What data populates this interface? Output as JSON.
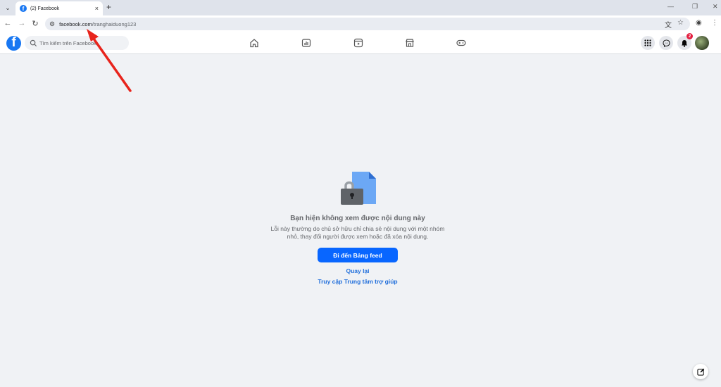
{
  "browser": {
    "tab_title": "(2) Facebook",
    "tab_close": "×",
    "new_tab": "+",
    "tab_menu": "⌄",
    "window_controls": [
      "—",
      "❐",
      "✕"
    ],
    "url_domain": "facebook.com",
    "url_path": "/tranghaiduong123"
  },
  "facebook": {
    "logo": "f",
    "search_placeholder": "Tìm kiếm trên Facebook",
    "notification_count": "2",
    "nav_icons": [
      "home-icon",
      "video-icon",
      "reels-icon",
      "marketplace-icon",
      "gaming-icon"
    ],
    "right_icons": [
      "menu-grid-icon",
      "messenger-icon",
      "bell-icon",
      "avatar"
    ]
  },
  "error": {
    "heading": "Bạn hiện không xem được nội dung này",
    "description": "Lỗi này thường do chủ sở hữu chỉ chia sẻ nội dung với một nhóm nhỏ, thay đổi người được xem hoặc đã xóa nội dung.",
    "feed_button": "Đi đến Bảng feed",
    "back_link": "Quay lại",
    "help_link": "Truy cập Trung tâm trợ giúp"
  },
  "colors": {
    "brand_blue": "#1877f2",
    "button_blue": "#0866ff",
    "link_blue": "#216fdb",
    "badge_red": "#e41e3f",
    "annotation_arrow": "#e8241c"
  }
}
